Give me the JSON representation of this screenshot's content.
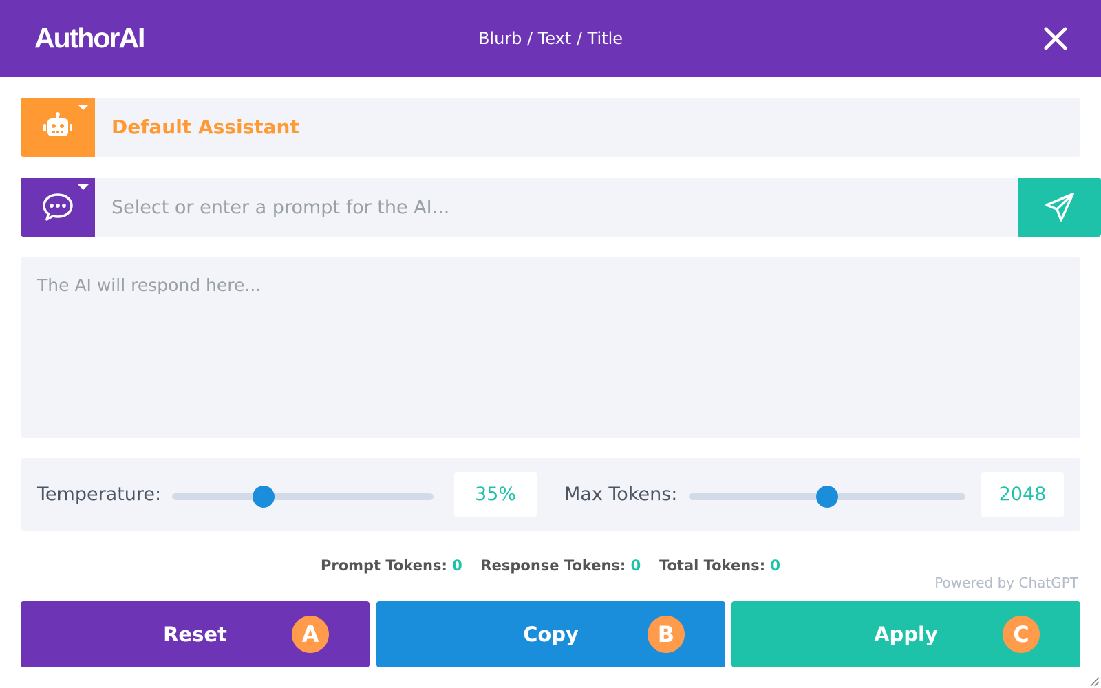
{
  "header": {
    "logo": "AuthorAI",
    "breadcrumb": "Blurb / Text / Title",
    "close_icon": "close-icon"
  },
  "assistant": {
    "icon": "robot-icon",
    "name": "Default Assistant"
  },
  "prompt": {
    "icon": "chat-bubble-icon",
    "placeholder": "Select or enter a prompt for the AI...",
    "value": "",
    "send_icon": "paper-plane-icon"
  },
  "response": {
    "placeholder": "The AI will respond here...",
    "value": ""
  },
  "settings": {
    "temperature": {
      "label": "Temperature:",
      "value_text": "35%",
      "fraction": 0.35
    },
    "max_tokens": {
      "label": "Max Tokens:",
      "value_text": "2048",
      "fraction": 0.5
    }
  },
  "tokens": {
    "prompt_label": "Prompt Tokens:",
    "prompt_value": "0",
    "response_label": "Response Tokens:",
    "response_value": "0",
    "total_label": "Total Tokens:",
    "total_value": "0"
  },
  "powered_by": "Powered by ChatGPT",
  "actions": [
    {
      "label": "Reset",
      "badge": "A"
    },
    {
      "label": "Copy",
      "badge": "B"
    },
    {
      "label": "Apply",
      "badge": "C"
    }
  ],
  "colors": {
    "primary_purple": "#6d35b6",
    "accent_orange": "#ff9933",
    "teal": "#1ec2a8",
    "blue": "#1a8ddb",
    "panel_bg": "#f2f4f9"
  }
}
